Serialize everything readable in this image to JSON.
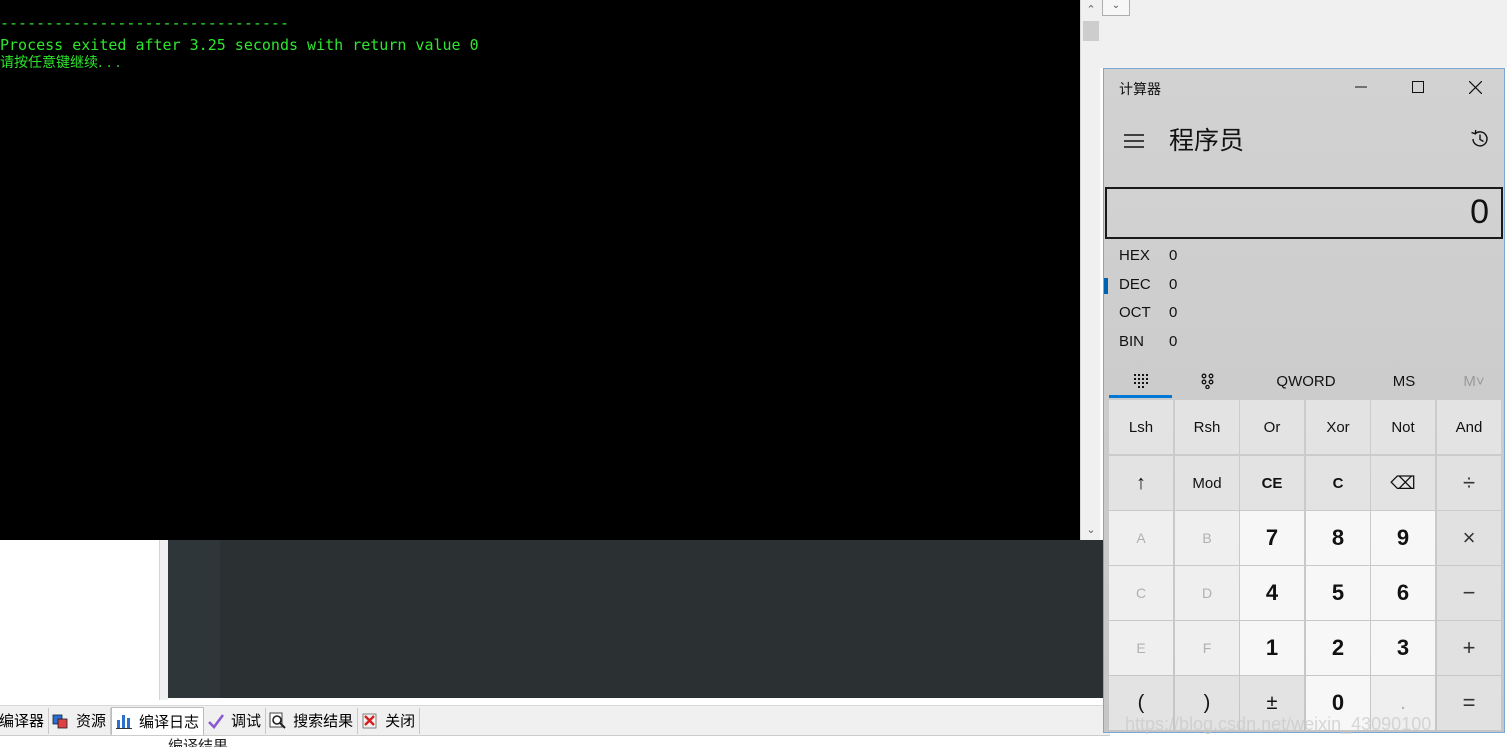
{
  "console": {
    "separator": "--------------------------------",
    "exit_message": "Process exited after 3.25 seconds with return value 0",
    "continue_prompt": "请按任意键继续. . ."
  },
  "ide": {
    "tabs": [
      {
        "label": "编译器",
        "icon": "compiler-icon"
      },
      {
        "label": "资源",
        "icon": "resources-icon"
      },
      {
        "label": "编译日志",
        "icon": "bar-chart-icon"
      },
      {
        "label": "调试",
        "icon": "checkmark-icon"
      },
      {
        "label": "搜索结果",
        "icon": "search-icon"
      },
      {
        "label": "关闭",
        "icon": "close-icon"
      }
    ],
    "bottom_panel_text": "编译结果",
    "top_dropdown": "⌄"
  },
  "calculator": {
    "title": "计算器",
    "mode": "程序员",
    "display": "0",
    "radix": [
      {
        "label": "HEX",
        "value": "0",
        "selected": false
      },
      {
        "label": "DEC",
        "value": "0",
        "selected": true
      },
      {
        "label": "OCT",
        "value": "0",
        "selected": false
      },
      {
        "label": "BIN",
        "value": "0",
        "selected": false
      }
    ],
    "tools": {
      "word_size": "QWORD",
      "memory_store": "MS",
      "memory_recall": "M˅"
    },
    "keys": {
      "lsh": "Lsh",
      "rsh": "Rsh",
      "or": "Or",
      "xor": "Xor",
      "not": "Not",
      "and": "And",
      "shift": "↑",
      "mod": "Mod",
      "ce": "CE",
      "c": "C",
      "backspace": "⌫",
      "divide": "÷",
      "a": "A",
      "b": "B",
      "seven": "7",
      "eight": "8",
      "nine": "9",
      "multiply": "×",
      "c_hex": "C",
      "d": "D",
      "four": "4",
      "five": "5",
      "six": "6",
      "minus": "−",
      "e": "E",
      "f": "F",
      "one": "1",
      "two": "2",
      "three": "3",
      "plus": "+",
      "lparen": "(",
      "rparen": ")",
      "negate": "±",
      "zero": "0",
      "decimal": ".",
      "equals": "="
    },
    "colors": {
      "accent": "#0078d7",
      "background": "#cbcbcb"
    }
  },
  "watermark": "https://blog.csdn.net/weixin_43090100"
}
